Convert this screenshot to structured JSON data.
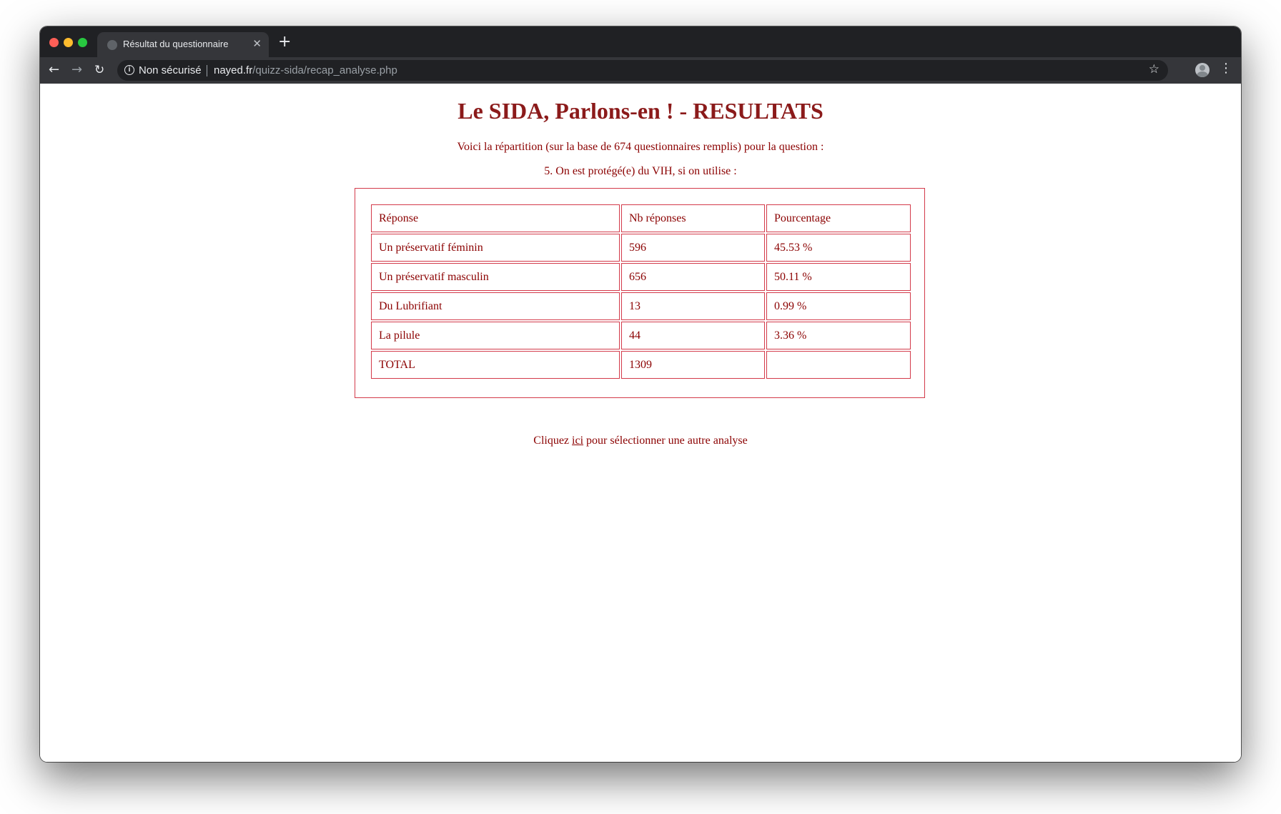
{
  "browser": {
    "tab_title": "Résultat du questionnaire",
    "security_label": "Non sécurisé",
    "url_host": "nayed.fr",
    "url_path": "/quizz-sida/recap_analyse.php"
  },
  "page": {
    "title": "Le SIDA, Parlons-en ! - RESULTATS",
    "intro": "Voici la répartition (sur la base de 674 questionnaires remplis) pour la question :",
    "question": "5. On est protégé(e) du VIH, si on utilise :"
  },
  "table": {
    "headers": [
      "Réponse",
      "Nb réponses",
      "Pourcentage"
    ],
    "rows": [
      [
        "Un préservatif féminin",
        "596",
        "45.53 %"
      ],
      [
        "Un préservatif masculin",
        "656",
        "50.11 %"
      ],
      [
        "Du Lubrifiant",
        "13",
        "0.99 %"
      ],
      [
        "La pilule",
        "44",
        "3.36 %"
      ]
    ],
    "total": [
      "TOTAL",
      "1309",
      ""
    ]
  },
  "footer": {
    "before": "Cliquez ",
    "link": "ici",
    "after": " pour sélectionner une autre analyse"
  },
  "colors": {
    "text": "#8b0000",
    "border": "#d33a4a",
    "chrome_dark": "#202124",
    "chrome_toolbar": "#35363a"
  },
  "icons": [
    "close-icon",
    "plus-icon",
    "back-arrow-icon",
    "forward-arrow-icon",
    "reload-icon",
    "info-icon",
    "star-icon",
    "profile-icon",
    "menu-icon"
  ]
}
